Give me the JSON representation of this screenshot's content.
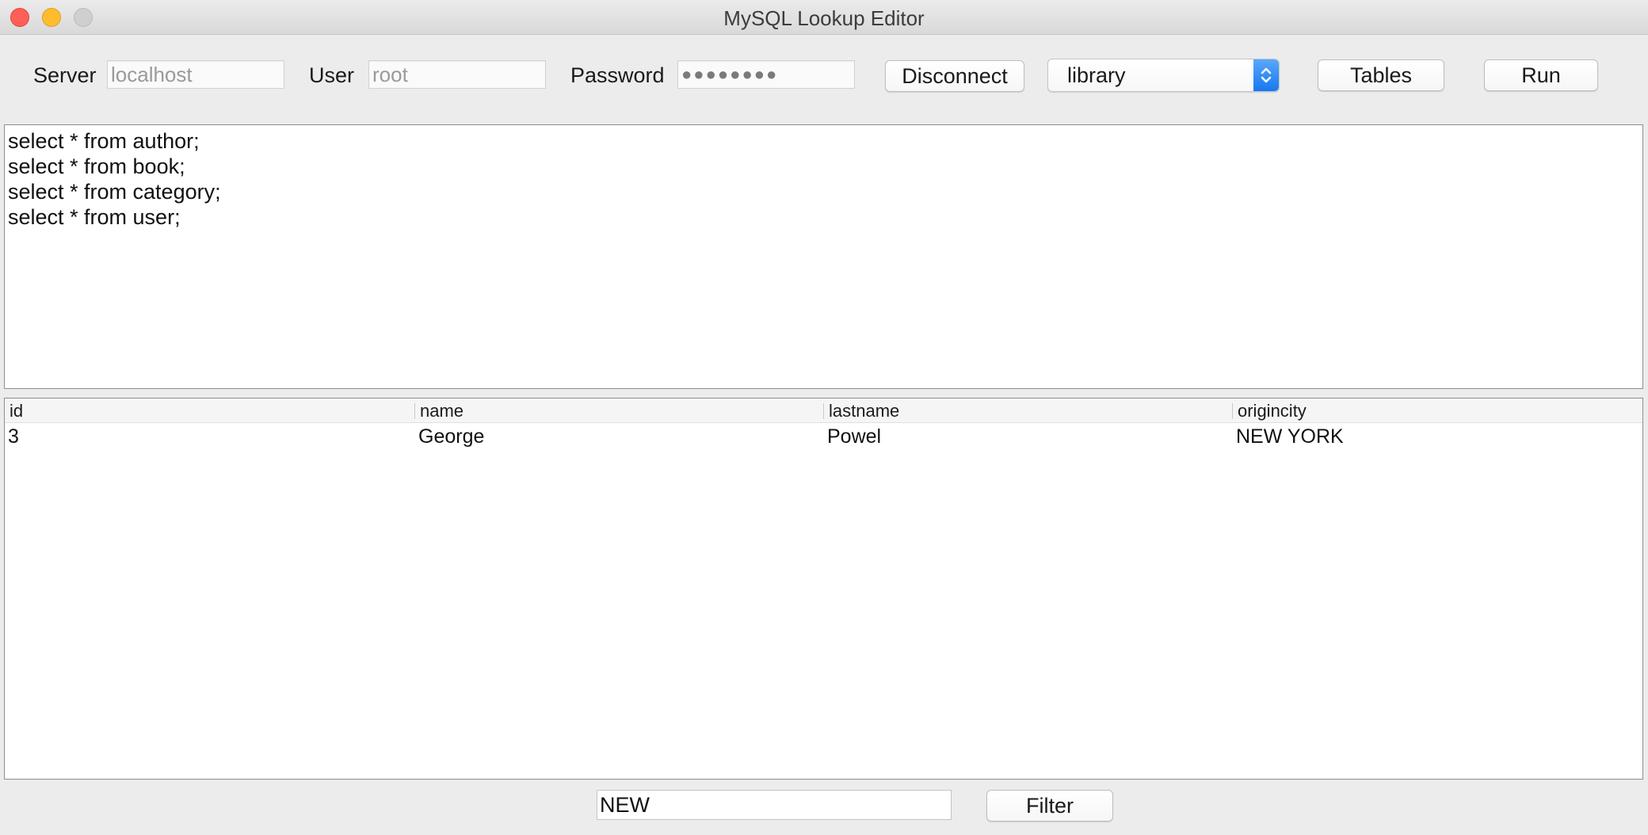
{
  "window": {
    "title": "MySQL Lookup Editor"
  },
  "connection": {
    "server_label": "Server",
    "server_placeholder": "localhost",
    "user_label": "User",
    "user_placeholder": "root",
    "password_label": "Password",
    "password_mask": "●●●●●●●●",
    "disconnect_label": "Disconnect",
    "database_selected": "library",
    "tables_label": "Tables",
    "run_label": "Run"
  },
  "query": {
    "lines": [
      "select * from author;",
      "select * from book;",
      "select * from category;",
      "select * from user;"
    ]
  },
  "results": {
    "columns": [
      "id",
      "name",
      "lastname",
      "origincity"
    ],
    "rows": [
      [
        "3",
        "George",
        "Powel",
        "NEW YORK"
      ]
    ]
  },
  "filter": {
    "value": "NEW",
    "button_label": "Filter"
  },
  "colors": {
    "accent": "#1778f0",
    "close": "#fe5f57",
    "minimize": "#febc2e",
    "zoom_inactive": "#cfcfcf"
  }
}
